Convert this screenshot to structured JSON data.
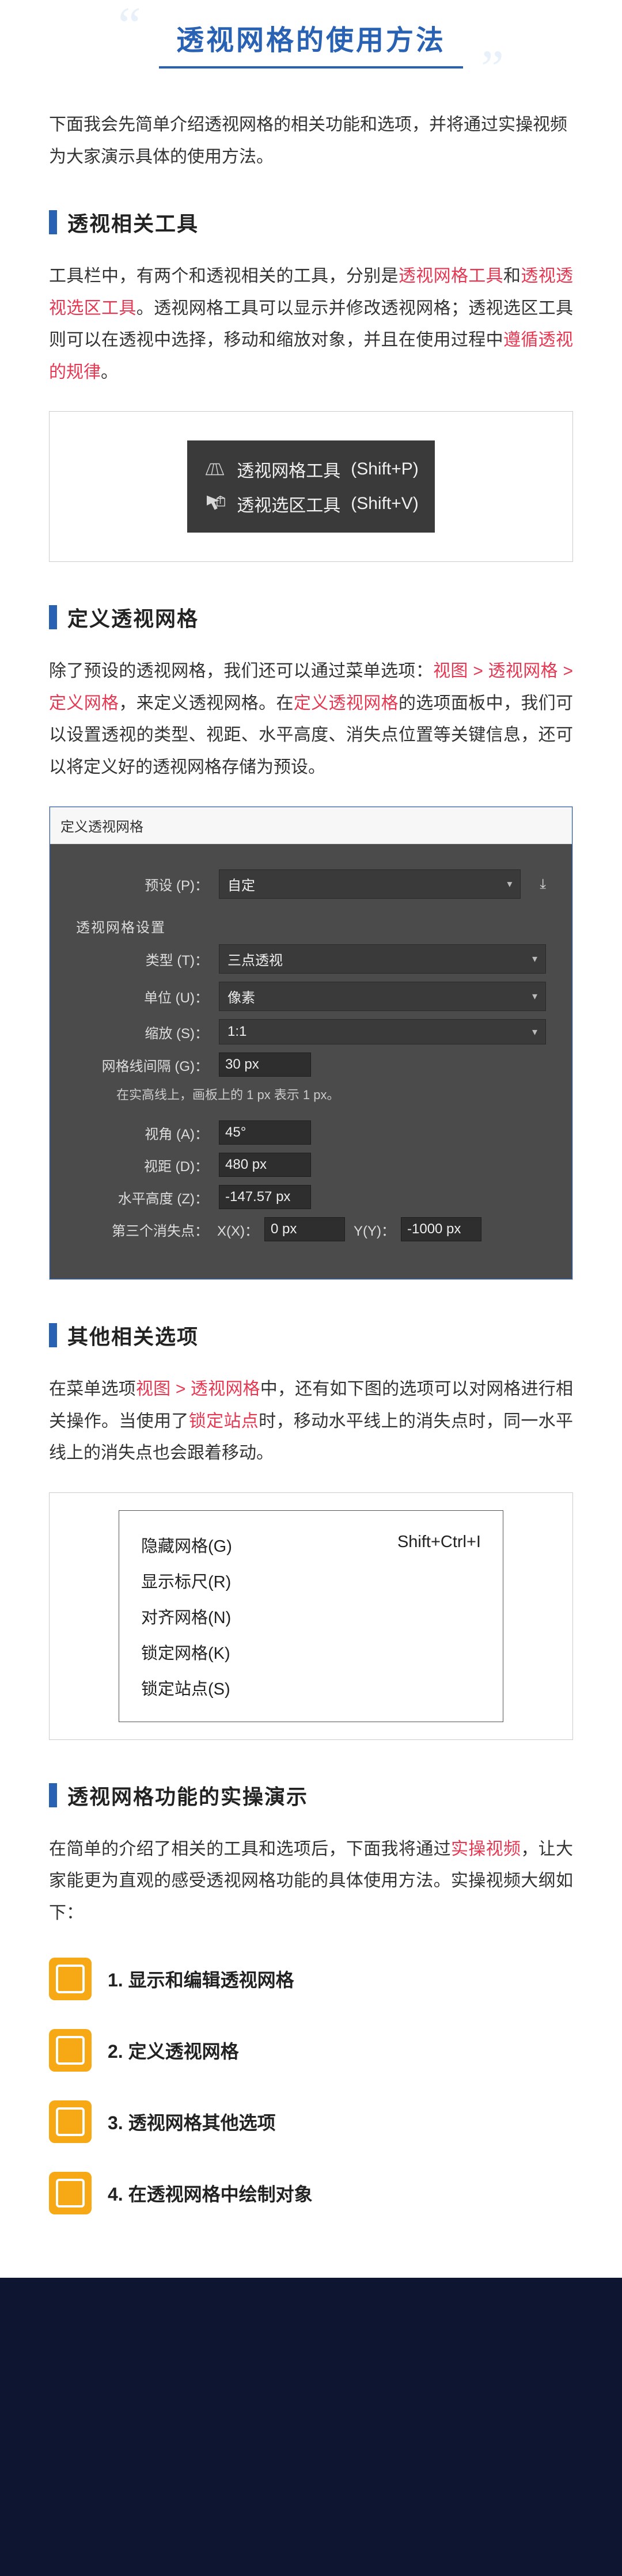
{
  "title": "透视网格的使用方法",
  "intro": "下面我会先简单介绍透视网格的相关功能和选项，并将通过实操视频为大家演示具体的使用方法。",
  "section1": {
    "heading": "透视相关工具",
    "p_a": "工具栏中，有两个和透视相关的工具，分别是",
    "hl1": "透视网格工具",
    "p_b": "和",
    "hl2": "透视透视选区工具",
    "p_c": "。透视网格工具可以显示并修改透视网格；透视选区工具则可以在透视中选择，移动和缩放对象，并且在使用过程中",
    "hl3": "遵循透视的规律",
    "p_d": "。"
  },
  "tool_panel": {
    "row1_label": "透视网格工具",
    "row1_sc": "(Shift+P)",
    "row2_label": "透视选区工具",
    "row2_sc": "(Shift+V)"
  },
  "section2": {
    "heading": "定义透视网格",
    "p_a": "除了预设的透视网格，我们还可以通过菜单选项：",
    "hl1": "视图 > 透视网格 > 定义网格",
    "p_b": "，来定义透视网格。在",
    "hl2": "定义透视网格",
    "p_c": "的选项面板中，我们可以设置透视的类型、视距、水平高度、消失点位置等关键信息，还可以将定义好的透视网格存储为预设。"
  },
  "dialog": {
    "title": "定义透视网格",
    "preset_lbl": "预设 (P)：",
    "preset_lbl_letter": "P",
    "preset_val": "自定",
    "group1": "透视网格设置",
    "type_lbl": "类型 (T)：",
    "type_val": "三点透视",
    "unit_lbl": "单位 (U)：",
    "unit_val": "像素",
    "scale_lbl": "缩放 (S)：",
    "scale_val": "1:1",
    "grid_gap_lbl": "网格线间隔 (G)：",
    "grid_gap_val": "30 px",
    "hint": "在实高线上，画板上的 1 px 表示 1 px。",
    "angle_lbl": "视角 (A)：",
    "angle_val": "45°",
    "dist_lbl": "视距 (D)：",
    "dist_val": "480 px",
    "hh_lbl": "水平高度 (Z)：",
    "hh_val": "-147.57 px",
    "vp3_lbl": "第三个消失点：",
    "vp3_x_lbl": "X(X)：",
    "vp3_x_val": "0 px",
    "vp3_y_lbl": "Y(Y)：",
    "vp3_y_val": "-1000 px"
  },
  "section3": {
    "heading": "其他相关选项",
    "p_a": "在菜单选项",
    "hl1": "视图 > 透视网格",
    "p_b": "中，还有如下图的选项可以对网格进行相关操作。当使用了",
    "hl2": "锁定站点",
    "p_c": "时，移动水平线上的消失点时，同一水平线上的消失点也会跟着移动。"
  },
  "menu": {
    "i1": "隐藏网格(G)",
    "i1_sc": "Shift+Ctrl+I",
    "i2": "显示标尺(R)",
    "i3": "对齐网格(N)",
    "i4": "锁定网格(K)",
    "i5": "锁定站点(S)"
  },
  "section4": {
    "heading": "透视网格功能的实操演示",
    "p_a": "在简单的介绍了相关的工具和选项后，下面我将通过",
    "hl1": "实操视频",
    "p_b": "，让大家能更为直观的感受透视网格功能的具体使用方法。实操视频大纲如下："
  },
  "demo": {
    "i1": "1. 显示和编辑透视网格",
    "i2": "2. 定义透视网格",
    "i3": "3. 透视网格其他选项",
    "i4": "4. 在透视网格中绘制对象"
  }
}
